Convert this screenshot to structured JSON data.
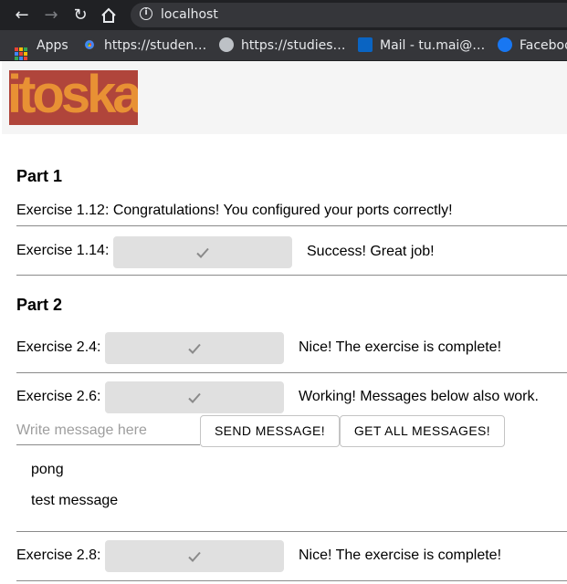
{
  "browser": {
    "url": "localhost",
    "bookmarks": [
      {
        "label": "Apps",
        "icon": "apps-grid-icon"
      },
      {
        "label": "https://studen…",
        "icon": "chrome-icon"
      },
      {
        "label": "https://studies…",
        "icon": "globe-icon"
      },
      {
        "label": "Mail - tu.mai@…",
        "icon": "outlook-icon"
      },
      {
        "label": "Faceboo",
        "icon": "facebook-icon"
      }
    ]
  },
  "logo": {
    "text": "itoska",
    "colors": {
      "background": "#b0453b",
      "text": "#e89134"
    }
  },
  "part1": {
    "title": "Part 1",
    "ex112": "Exercise 1.12: Congratulations! You configured your ports correctly!",
    "ex114_label": "Exercise 1.14:",
    "ex114_status": "Success! Great job!"
  },
  "part2": {
    "title": "Part 2",
    "ex24_label": "Exercise 2.4:",
    "ex24_status": "Nice! The exercise is complete!",
    "ex26_label": "Exercise 2.6:",
    "ex26_status": "Working! Messages below also work.",
    "message_placeholder": "Write message here",
    "send_label": "SEND MESSAGE!",
    "get_all_label": "GET ALL MESSAGES!",
    "messages": [
      "pong",
      "test message"
    ],
    "ex28_label": "Exercise 2.8:",
    "ex28_status": "Nice! The exercise is complete!"
  },
  "colors": {
    "button_bg": "#e0e0e0",
    "check": "#8a8a8a",
    "divider": "#8a8a8a"
  }
}
